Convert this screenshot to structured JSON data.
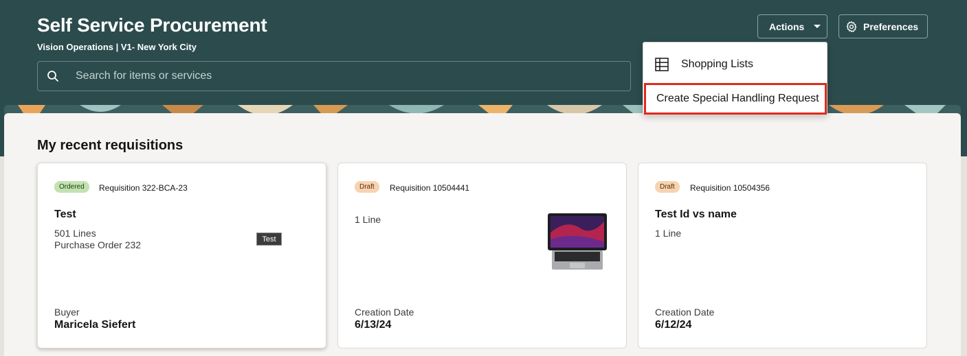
{
  "header": {
    "title": "Self Service Procurement",
    "subtitle": "Vision Operations | V1- New York City",
    "search_placeholder": "Search for items or services",
    "actions_label": "Actions",
    "preferences_label": "Preferences"
  },
  "actions_menu": {
    "items": [
      {
        "label": "Shopping Lists",
        "icon": "grid-list-icon"
      },
      {
        "label": "Create Special Handling Request",
        "highlighted": true
      }
    ]
  },
  "recent": {
    "title": "My recent requisitions",
    "cards": [
      {
        "status": "Ordered",
        "requisition": "Requisition 322-BCA-23",
        "title": "Test",
        "lines": "501 Lines",
        "order": "Purchase Order 232",
        "tooltip": "Test",
        "footer_label": "Buyer",
        "footer_value": "Maricela Siefert"
      },
      {
        "status": "Draft",
        "requisition": "Requisition 10504441",
        "lines": "1 Line",
        "image": "laptop-image",
        "footer_label": "Creation Date",
        "footer_value": "6/13/24"
      },
      {
        "status": "Draft",
        "requisition": "Requisition 10504356",
        "title": "Test Id vs name",
        "lines": "1 Line",
        "footer_label": "Creation Date",
        "footer_value": "6/12/24"
      }
    ]
  },
  "colors": {
    "header_bg": "#2b4b4d",
    "ordered_badge": "#c3e2b1",
    "draft_badge": "#f7d3b1",
    "highlight_border": "#e0291b"
  }
}
